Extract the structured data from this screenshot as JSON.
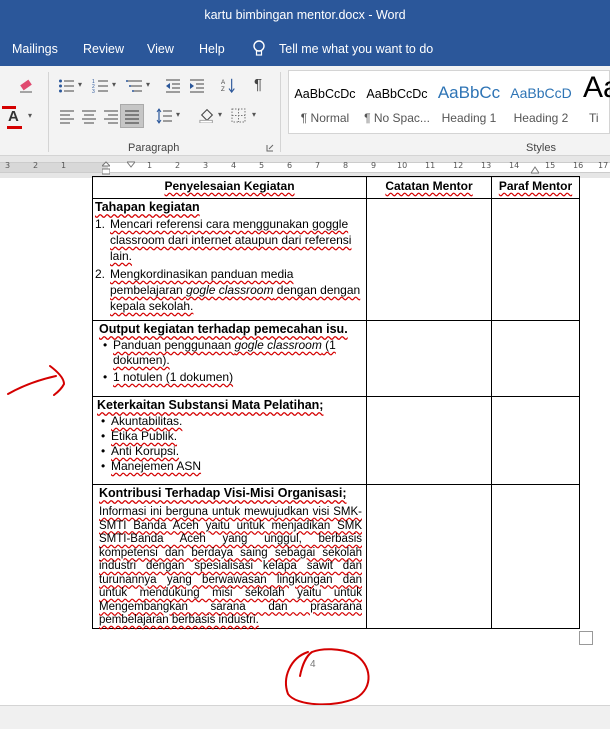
{
  "window": {
    "title": "kartu bimbingan mentor.docx  -  Word"
  },
  "tabs": [
    {
      "label": "Mailings"
    },
    {
      "label": "Review"
    },
    {
      "label": "View"
    },
    {
      "label": "Help"
    }
  ],
  "tellme": {
    "label": "Tell me what you want to do"
  },
  "ribbon": {
    "paragraph_label": "Paragraph",
    "styles_label": "Styles",
    "styles": [
      {
        "sample": "AaBbCcDc",
        "name": "¶ Normal"
      },
      {
        "sample": "AaBbCcDc",
        "name": "¶ No Spac..."
      },
      {
        "sample": "AaBbCc",
        "name": "Heading 1"
      },
      {
        "sample": "AaBbCcD",
        "name": "Heading 2"
      },
      {
        "sample": "Aa",
        "name": "Ti"
      }
    ]
  },
  "ruler": {
    "numbers": [
      "3",
      "2",
      "1",
      "1",
      "2",
      "3",
      "4",
      "5",
      "6",
      "7",
      "8",
      "9",
      "10",
      "11",
      "12",
      "13",
      "14",
      "15",
      "16",
      "17"
    ]
  },
  "table": {
    "headers": [
      "Penyelesaian Kegiatan",
      "Catatan Mentor",
      "Paraf Mentor"
    ],
    "section1": {
      "title": "Tahapan kegiatan",
      "items": [
        {
          "num": "1.",
          "text": "Mencari referensi cara menggunakan goggle classroom dari internet ataupun dari referensi lain."
        },
        {
          "num": "2.",
          "text": "Mengkordinasikan  panduan media pembelajaran ",
          "italic": "gogle classroom",
          "text2": " dengan dengan kepala sekolah."
        }
      ]
    },
    "section2": {
      "title": "Output kegiatan terhadap pemecahan isu.",
      "items": [
        {
          "text": "Panduan penggunaan ",
          "italic": "gogle classroom",
          "text2": " (1 dokumen)."
        },
        {
          "text": "1 notulen (1 dokumen)"
        }
      ]
    },
    "section3": {
      "title": "Keterkaitan Substansi Mata Pelatihan;",
      "items": [
        {
          "text": "Akuntabilitas."
        },
        {
          "text": "Etika Publik."
        },
        {
          "text": "Anti Korupsi."
        },
        {
          "text": "Manejemen ASN"
        }
      ]
    },
    "section4": {
      "title": "Kontribusi Terhadap Visi-Misi Organisasi;",
      "paragraph": "Informasi ini berguna untuk mewujudkan visi SMK-SMTI Banda Aceh yaitu untuk menjadikan SMK SMTI-Banda Aceh yang       unggul, berbasis kompetensi dan berdaya saing sebagai sekolah industri dengan spesialisasi kelapa sawit dan turunannya yang berwawasan  lingkungan dan untuk mendukung misi sekolah yaitu untuk Mengembangkan sarana dan prasarana pembelajaran berbasis industri."
    }
  },
  "page_number": "4",
  "colors": {
    "word_blue": "#2b579a",
    "annotation_red": "#d40000"
  }
}
